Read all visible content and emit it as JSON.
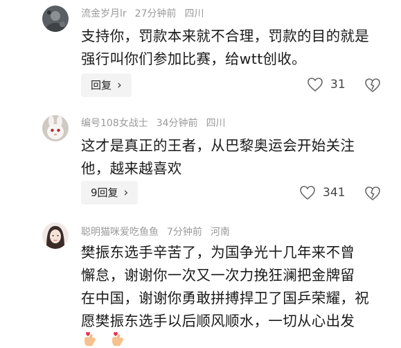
{
  "comments": [
    {
      "username": "流金岁月lr",
      "time": "27分钟前",
      "location": "四川",
      "text_lines": [
        "支持你，罚款本来就不合理，罚款的目的就是",
        "强行叫你们参加比赛，给wtt创收。"
      ],
      "reply_label": "回复",
      "likes": "31",
      "avatar_icon": "avatar-gray-photo-icon"
    },
    {
      "username": "编号108女战士",
      "time": "34分钟前",
      "location": "四川",
      "text_lines": [
        "这才是真正的王者，从巴黎奥运会开始关注",
        "他，越来越喜欢"
      ],
      "reply_label": "9回复",
      "likes": "341",
      "avatar_icon": "avatar-rabbit-icon"
    },
    {
      "username": "聪明猫咪爱吃鱼鱼",
      "time": "7分钟前",
      "location": "河南",
      "text_lines": [
        "樊振东选手辛苦了，为国争光十几年来不曾",
        "懈怠，谢谢你一次又一次力挽狂澜把金牌留",
        "在中国，谢谢你勇敢拼搏捍卫了国乒荣耀，祝",
        "愿樊振东选手以后顺风顺水，一切从心出发"
      ],
      "emojis": [
        "finger-heart-icon",
        "finger-heart-icon"
      ],
      "avatar_icon": "avatar-girl-photo-icon"
    }
  ],
  "colors": {
    "meta": "#9a9a9a",
    "text": "#1a1a1a",
    "reply_bg": "#f3f3f3"
  }
}
